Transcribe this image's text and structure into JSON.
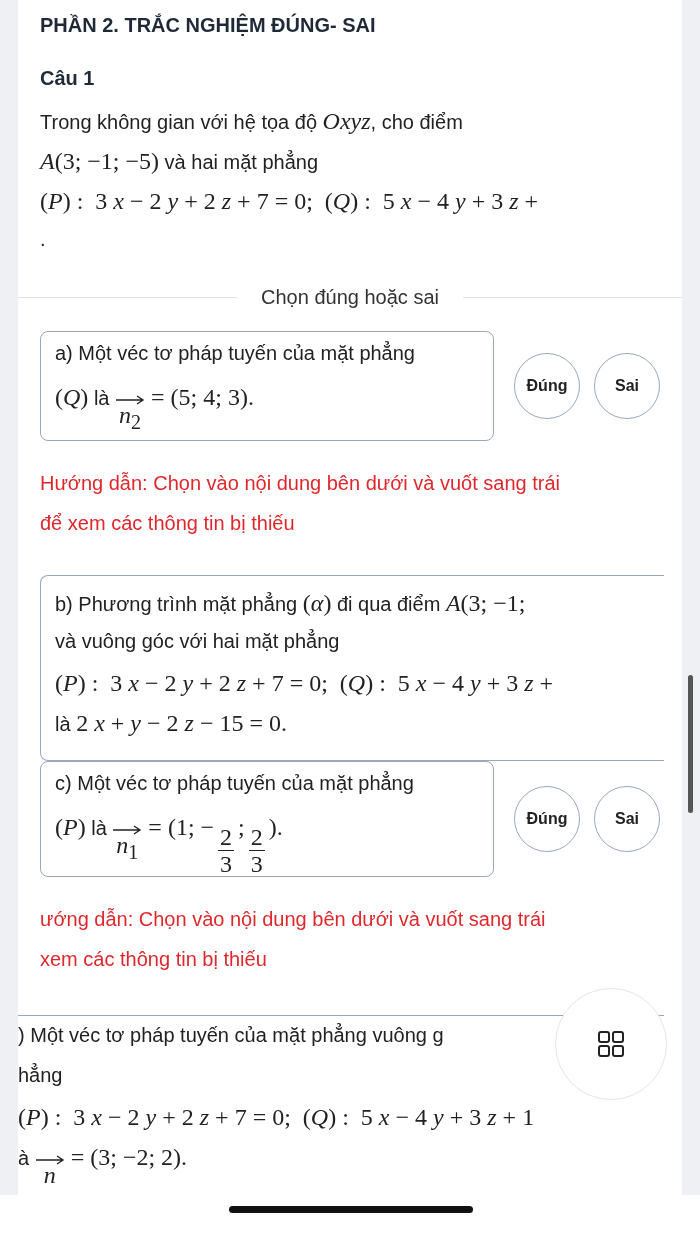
{
  "title": "PHẦN 2. TRẮC NGHIỆM ĐÚNG- SAI",
  "question_label": "Câu 1",
  "stem": [
    [
      {
        "kind": "text",
        "text": "Trong không gian với hệ tọa độ "
      },
      {
        "kind": "math",
        "text": "*Oxyz*"
      },
      {
        "kind": "text",
        "text": ", cho điểm"
      }
    ],
    [
      {
        "kind": "math",
        "text": "*A*(3; −1; −5)"
      },
      {
        "kind": "text",
        "text": " và hai mặt phẳng"
      }
    ],
    [
      {
        "kind": "math",
        "text": "(*P*) :  3 *x* − 2 *y* + 2 *z* + 7 = 0;  (*Q*) :  5 *x* − 4 *y* + 3 *z* +"
      }
    ],
    [
      {
        "kind": "text",
        "text": "."
      }
    ]
  ],
  "divider_label": "Chọn đúng hoặc sai",
  "items": [
    {
      "kind": "card",
      "lines": [
        [
          {
            "kind": "text",
            "text": "a) Một véc tơ pháp tuyến của mặt phẳng"
          }
        ],
        [
          {
            "kind": "math",
            "text": "(*Q*)"
          },
          {
            "kind": "text",
            "text": " là "
          },
          {
            "kind": "vec",
            "text": "*n*$_{2}$"
          },
          {
            "kind": "math",
            "text": " = (5; 4; 3)."
          }
        ]
      ],
      "buttons": [
        {
          "label": "Đúng",
          "selected": false
        },
        {
          "label": "Sai",
          "selected": false
        }
      ],
      "hint": [
        "Hướng dẫn: Chọn vào nội dung bên dưới và vuốt sang trái",
        "để xem các thông tin bị thiếu"
      ]
    },
    {
      "kind": "open",
      "lines": [
        [
          {
            "kind": "text",
            "text": "b) Phương trình mặt phẳng "
          },
          {
            "kind": "math",
            "text": "(*α*)"
          },
          {
            "kind": "text",
            "text": " đi qua điểm "
          },
          {
            "kind": "math",
            "text": "*A*(3; −1;"
          }
        ],
        [
          {
            "kind": "text",
            "text": "và vuông góc với hai mặt phẳng"
          }
        ],
        [
          {
            "kind": "math",
            "text": "(*P*) :  3 *x* − 2 *y* + 2 *z* + 7 = 0;  (*Q*) :  5 *x* − 4 *y* + 3 *z* +"
          }
        ],
        [
          {
            "kind": "text",
            "text": "là "
          },
          {
            "kind": "math",
            "text": "2 *x* + *y* − 2 *z* − 15 = 0."
          }
        ]
      ]
    },
    {
      "kind": "card",
      "lines": [
        [
          {
            "kind": "text",
            "text": "c) Một véc tơ pháp tuyến của mặt phẳng"
          }
        ],
        [
          {
            "kind": "math",
            "text": "(*P*)"
          },
          {
            "kind": "text",
            "text": " là "
          },
          {
            "kind": "vec",
            "text": "*n*$_{1}$"
          },
          {
            "kind": "math",
            "text": " = (1; −"
          },
          {
            "kind": "frac",
            "num": "2",
            "den": "3"
          },
          {
            "kind": "math",
            "text": ";"
          },
          {
            "kind": "frac",
            "num": "2",
            "den": "3"
          },
          {
            "kind": "math",
            "text": ")."
          }
        ]
      ],
      "buttons": [
        {
          "label": "Đúng",
          "selected": false
        },
        {
          "label": "Sai",
          "selected": false
        }
      ],
      "hint": [
        "ướng dẫn: Chọn vào nội dung bên dưới và vuốt sang trái",
        "xem các thông tin bị thiếu"
      ]
    },
    {
      "kind": "rule",
      "lines": [
        [
          {
            "kind": "text",
            "text": ") Một véc tơ pháp tuyến của mặt phẳng vuông g"
          }
        ],
        [
          {
            "kind": "text",
            "text": "hẳng"
          }
        ],
        [
          {
            "kind": "math",
            "text": "(*P*) :  3 *x* − 2 *y* + 2 *z* + 7 = 0;  (*Q*) :  5 *x* − 4 *y* + 3 *z* + 1"
          }
        ],
        [
          {
            "kind": "text",
            "text": "à "
          },
          {
            "kind": "vec",
            "text": "*n*"
          },
          {
            "kind": "math",
            "text": " = (3; −2; 2)."
          }
        ]
      ]
    }
  ]
}
